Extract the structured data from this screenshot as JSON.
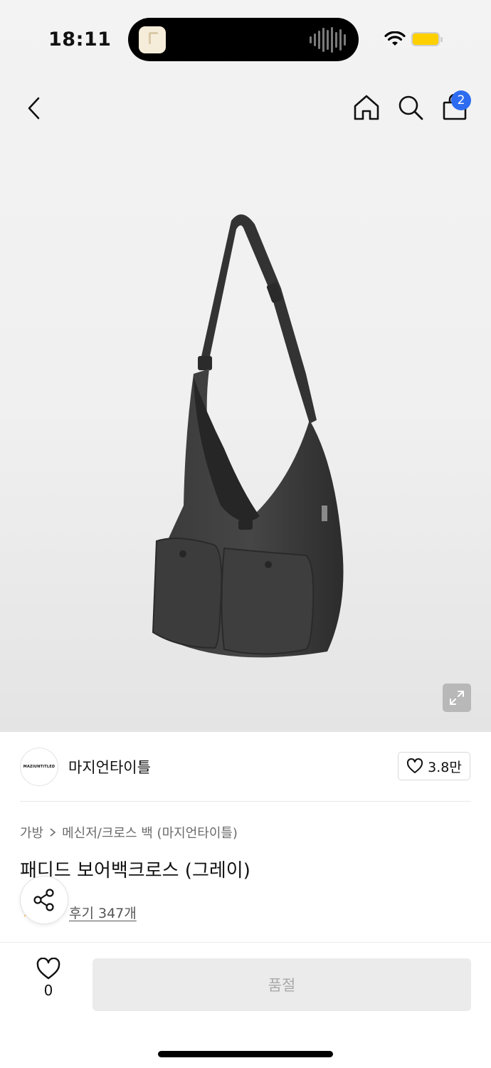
{
  "status_bar": {
    "time": "18:11",
    "battery_color": "#ffd000"
  },
  "nav": {
    "back_icon": "chevron-left-icon",
    "home_icon": "home-icon",
    "search_icon": "search-icon",
    "bag_icon": "shopping-bag-icon",
    "cart_badge": "2",
    "badge_color": "#2d6cf0"
  },
  "product": {
    "brand_logo_text": "MAZIUNTITLED",
    "brand_name": "마지언타이틀",
    "brand_likes": "3.8만",
    "breadcrumb": {
      "category": "가방",
      "subcategory": "메신저/크로스 백 (마지언타이틀)"
    },
    "title": "패디드 보어백크로스 (그레이)",
    "reviews": "후기 347개"
  },
  "bottom_bar": {
    "wish_count": "0",
    "purchase_label": "품절"
  }
}
